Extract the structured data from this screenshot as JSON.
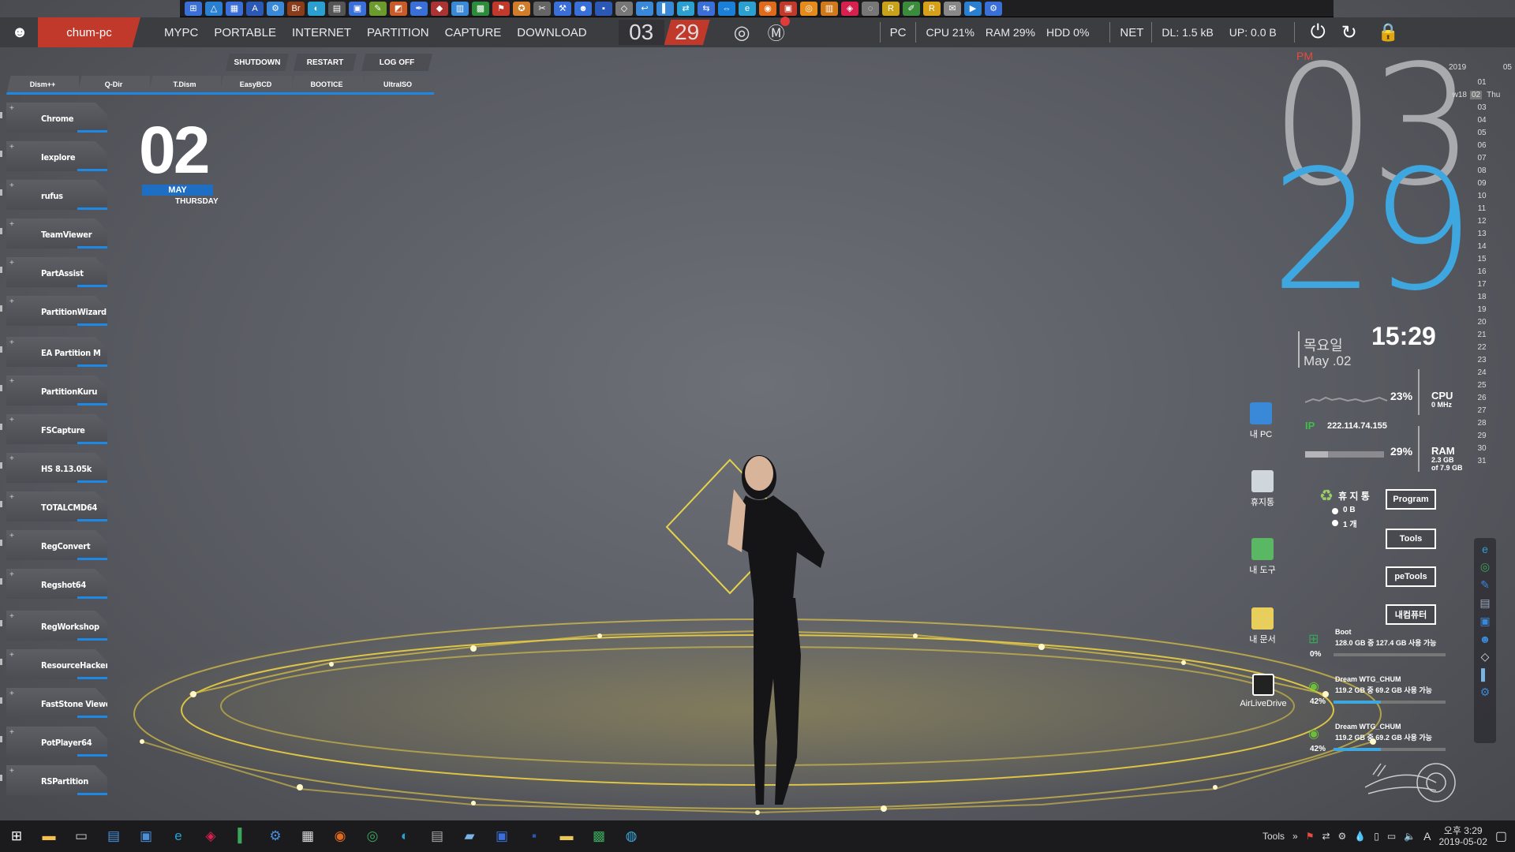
{
  "colors": {
    "accent": "#1e88e5",
    "brand_red": "#c0392b",
    "clock_blue": "#3fa7e0",
    "ampm_red": "#e74c3c",
    "glow": "#f5d742"
  },
  "quicklaunch": [
    {
      "icon": "windows-flag-icon",
      "color": "#3a6fd8",
      "glyph": "⊞"
    },
    {
      "icon": "drive-icon",
      "color": "#2a7fd0",
      "glyph": "△"
    },
    {
      "icon": "grid-icon",
      "color": "#3a6fd8",
      "glyph": "▦"
    },
    {
      "icon": "font-a-icon",
      "color": "#2b58b4",
      "glyph": "A"
    },
    {
      "icon": "network-icon",
      "color": "#3a88d8",
      "glyph": "⚙"
    },
    {
      "icon": "br-icon",
      "color": "#8b3c1a",
      "glyph": "Br"
    },
    {
      "icon": "disk-icon",
      "color": "#2a9fd0",
      "glyph": "◐"
    },
    {
      "icon": "printer-icon",
      "color": "#555",
      "glyph": "▤"
    },
    {
      "icon": "monitor-icon",
      "color": "#3a6fd8",
      "glyph": "▣"
    },
    {
      "icon": "paint-icon",
      "color": "#6b9a2d",
      "glyph": "✎"
    },
    {
      "icon": "photo-icon",
      "color": "#c95b2b",
      "glyph": "◩"
    },
    {
      "icon": "pen-icon",
      "color": "#3a6fd8",
      "glyph": "✒"
    },
    {
      "icon": "tag-icon",
      "color": "#a33",
      "glyph": "◆"
    },
    {
      "icon": "folder-net-icon",
      "color": "#3a88d8",
      "glyph": "▥"
    },
    {
      "icon": "terminal-icon",
      "color": "#2d8c3c",
      "glyph": "▩"
    },
    {
      "icon": "flag-icon",
      "color": "#c0392b",
      "glyph": "⚑"
    },
    {
      "icon": "gear-orange-icon",
      "color": "#d07c2b",
      "glyph": "✪"
    },
    {
      "icon": "wrench-icon",
      "color": "#666",
      "glyph": "✂"
    },
    {
      "icon": "tools-icon",
      "color": "#3a6fd8",
      "glyph": "⚒"
    },
    {
      "icon": "users-icon",
      "color": "#3a6fd8",
      "glyph": "☻"
    },
    {
      "icon": "floppy-icon",
      "color": "#2b58b4",
      "glyph": "▪"
    },
    {
      "icon": "diamond-icon",
      "color": "#777",
      "glyph": "◇"
    },
    {
      "icon": "arrow-icon",
      "color": "#3a88d8",
      "glyph": "↩"
    },
    {
      "icon": "book-icon",
      "color": "#3a88d8",
      "glyph": "▌"
    },
    {
      "icon": "swap-icon",
      "color": "#2a9fd0",
      "glyph": "⇄"
    },
    {
      "icon": "remote-icon",
      "color": "#3a6fd8",
      "glyph": "⇆"
    },
    {
      "icon": "teamviewer-icon",
      "color": "#1a7fd8",
      "glyph": "⇔"
    },
    {
      "icon": "ie-icon",
      "color": "#2a9fd0",
      "glyph": "e"
    },
    {
      "icon": "firefox-icon",
      "color": "#e06a1b",
      "glyph": "◉"
    },
    {
      "icon": "reader-icon",
      "color": "#c0392b",
      "glyph": "▣"
    },
    {
      "icon": "chrome-alt-icon",
      "color": "#e68a1b",
      "glyph": "◎"
    },
    {
      "icon": "memory-icon",
      "color": "#d0791b",
      "glyph": "▥"
    },
    {
      "icon": "app-red-icon",
      "color": "#d6204e",
      "glyph": "◈"
    },
    {
      "icon": "net-grey-icon",
      "color": "#777",
      "glyph": "◌"
    },
    {
      "icon": "r-icon",
      "color": "#c9a21b",
      "glyph": "R"
    },
    {
      "icon": "pen-green-icon",
      "color": "#3a8c3c",
      "glyph": "✐"
    },
    {
      "icon": "r2-icon",
      "color": "#d6a01b",
      "glyph": "R"
    },
    {
      "icon": "note-icon",
      "color": "#888",
      "glyph": "✉"
    },
    {
      "icon": "play-icon",
      "color": "#2a7fd0",
      "glyph": "▶"
    },
    {
      "icon": "settings-icon",
      "color": "#3a6fd8",
      "glyph": "⚙"
    }
  ],
  "status": {
    "hostname": "chum-pc",
    "menu": [
      "MYPC",
      "PORTABLE",
      "INTERNET",
      "PARTITION",
      "CAPTURE",
      "DOWNLOAD"
    ],
    "hour": "03",
    "minute": "29",
    "pc_label": "PC",
    "cpu": "CPU  21%",
    "ram": "RAM  29%",
    "hdd": "HDD  0%",
    "net_label": "NET",
    "dl": "DL: 1.5 kB",
    "up": "UP: 0.0 B"
  },
  "power_buttons": [
    "SHUTDOWN",
    "RESTART",
    "LOG OFF"
  ],
  "tool_tabs": [
    "Dism++",
    "Q-Dir",
    "T.Dism",
    "EasyBCD",
    "BOOTICE",
    "UltraISO"
  ],
  "launchers": [
    "Chrome",
    "Iexplore",
    "rufus",
    "TeamViewer",
    "PartAssist",
    "PartitionWizard",
    "EA Partition M",
    "PartitionKuru",
    "FSCapture",
    "HS 8.13.05k",
    "TOTALCMD64",
    "RegConvert",
    "Regshot64",
    "RegWorkshop",
    "ResourceHacker",
    "FastStone Viewer",
    "PotPlayer64",
    "RSPartition"
  ],
  "date_widget": {
    "day": "02",
    "month": "MAY",
    "weekday": "THURSDAY"
  },
  "clock": {
    "ampm": "PM",
    "hour": "03",
    "minute": "29",
    "time": "15:29",
    "korean_day": "목요일",
    "date_short": "May .02"
  },
  "calendar": {
    "year": "2019",
    "month": "05",
    "week": "w18",
    "current": "02",
    "dow": "Thu",
    "days": [
      "01",
      "02",
      "03",
      "04",
      "05",
      "06",
      "07",
      "08",
      "09",
      "10",
      "11",
      "12",
      "13",
      "14",
      "15",
      "16",
      "17",
      "18",
      "19",
      "20",
      "21",
      "22",
      "23",
      "24",
      "25",
      "26",
      "27",
      "28",
      "29",
      "30",
      "31"
    ]
  },
  "stats": {
    "cpu_pct": "23%",
    "cpu_label": "CPU",
    "cpu_mhz": "0 MHz",
    "ip_label": "IP",
    "ip": "222.114.74.155",
    "ram_pct": "29%",
    "ram_label": "RAM",
    "ram_used": "2.3 GB",
    "ram_total": "of 7.9 GB"
  },
  "recycle": {
    "title": "휴 지 통",
    "size": "0 B",
    "count": "1 개"
  },
  "right_buttons": [
    "Program",
    "Tools",
    "peTools",
    "내컴퓨터"
  ],
  "desktop_icons": [
    "내 PC",
    "휴지통",
    "내 도구",
    "내 문서",
    "AirLiveDrive"
  ],
  "drives": [
    {
      "name": "Boot",
      "detail": "128.0 GB 중 127.4 GB 사용 가능",
      "pct": "0%",
      "fill": 0.0
    },
    {
      "name": "Dream WTG_CHUM",
      "detail": "119.2 GB 중 69.2 GB 사용 가능",
      "pct": "42%",
      "fill": 0.42
    },
    {
      "name": "Dream WTG_CHUM",
      "detail": "119.2 GB 중 69.2 GB 사용 가능",
      "pct": "42%",
      "fill": 0.42
    }
  ],
  "taskbar": {
    "apps": [
      {
        "icon": "start-icon",
        "glyph": "⊞",
        "color": "#fff"
      },
      {
        "icon": "file-explorer-icon",
        "glyph": "▬",
        "color": "#f2c14e"
      },
      {
        "icon": "cmd-icon",
        "glyph": "▭",
        "color": "#ccc"
      },
      {
        "icon": "device-icon",
        "glyph": "▤",
        "color": "#4a90d9"
      },
      {
        "icon": "monitor-tool-icon",
        "glyph": "▣",
        "color": "#4a90d9"
      },
      {
        "icon": "ie-icon",
        "glyph": "e",
        "color": "#2a9fd0"
      },
      {
        "icon": "app-red-icon",
        "glyph": "◈",
        "color": "#d6204e"
      },
      {
        "icon": "green-blue-icon",
        "glyph": "▍",
        "color": "#3aa65a"
      },
      {
        "icon": "settings-box-icon",
        "glyph": "⚙",
        "color": "#4a90d9"
      },
      {
        "icon": "panel-icon",
        "glyph": "▦",
        "color": "#ddd"
      },
      {
        "icon": "firefox-icon",
        "glyph": "◉",
        "color": "#e06a1b"
      },
      {
        "icon": "chrome-icon",
        "glyph": "◎",
        "color": "#3aa65a"
      },
      {
        "icon": "teal-disk-icon",
        "glyph": "◐",
        "color": "#2a9fd0"
      },
      {
        "icon": "printer-icon",
        "glyph": "▤",
        "color": "#aaa"
      },
      {
        "icon": "book-icon",
        "glyph": "▰",
        "color": "#7ab3e6"
      },
      {
        "icon": "windows-icon",
        "glyph": "▣",
        "color": "#3a6fd8"
      },
      {
        "icon": "floppy-icon",
        "glyph": "▪",
        "color": "#2b58b4"
      },
      {
        "icon": "folder-arrow-icon",
        "glyph": "▬",
        "color": "#e8c85b"
      },
      {
        "icon": "tool-green-icon",
        "glyph": "▩",
        "color": "#3aa65a"
      },
      {
        "icon": "network-globe-icon",
        "glyph": "◍",
        "color": "#3aa6d8"
      }
    ],
    "tools_label": "Tools",
    "tray_ampm": "오후 3:29",
    "tray_date": "2019-05-02"
  }
}
